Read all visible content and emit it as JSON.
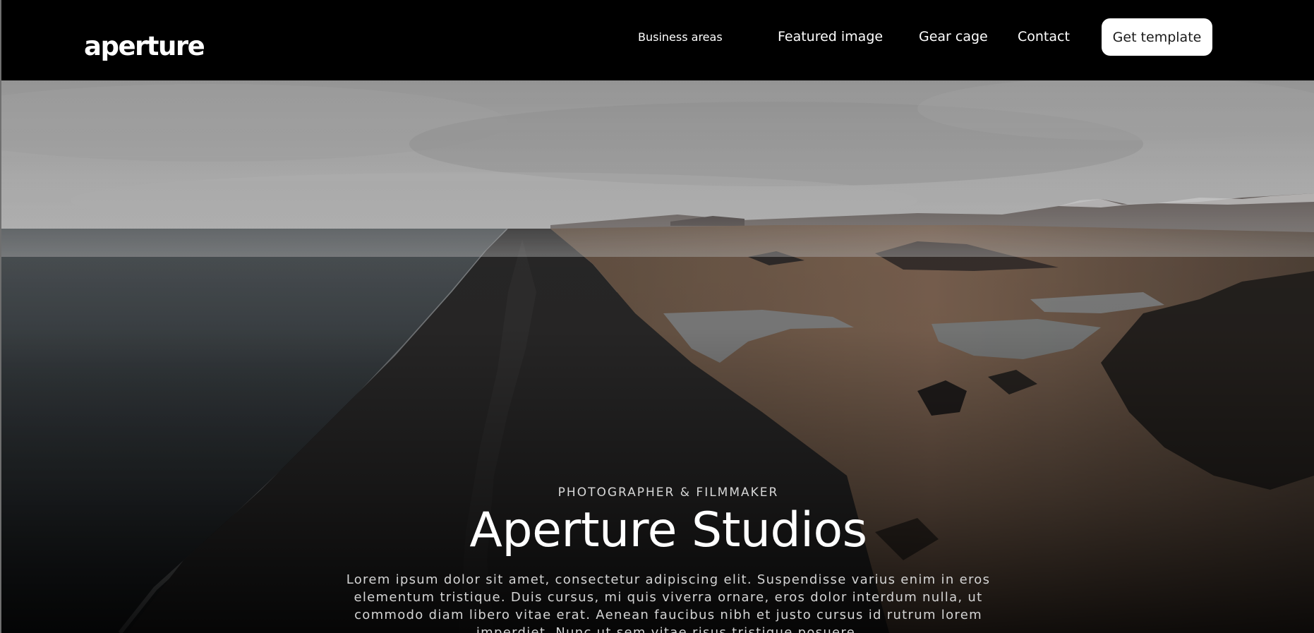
{
  "header": {
    "logo_text": "aperture",
    "nav": {
      "business_areas": "Business areas",
      "featured_image": "Featured image",
      "gear_cage": "Gear cage",
      "contact": "Contact"
    },
    "cta_label": "Get template"
  },
  "hero": {
    "eyebrow": "PHOTOGRAPHER & FILMMAKER",
    "title": "Aperture Studios",
    "body": "Lorem ipsum dolor sit amet, consectetur adipiscing elit. Suspendisse varius enim in eros elementum tristique. Duis cursus, mi quis viverra ornare, eros dolor interdum nulla, ut commodo diam libero vitae erat. Aenean faucibus nibh et justo cursus id rutrum lorem imperdiet. Nunc ut sem vitae risus tristique posuere."
  },
  "colors": {
    "header_bg": "#000000",
    "cta_bg": "#ffffff",
    "text_primary": "#ffffff"
  }
}
